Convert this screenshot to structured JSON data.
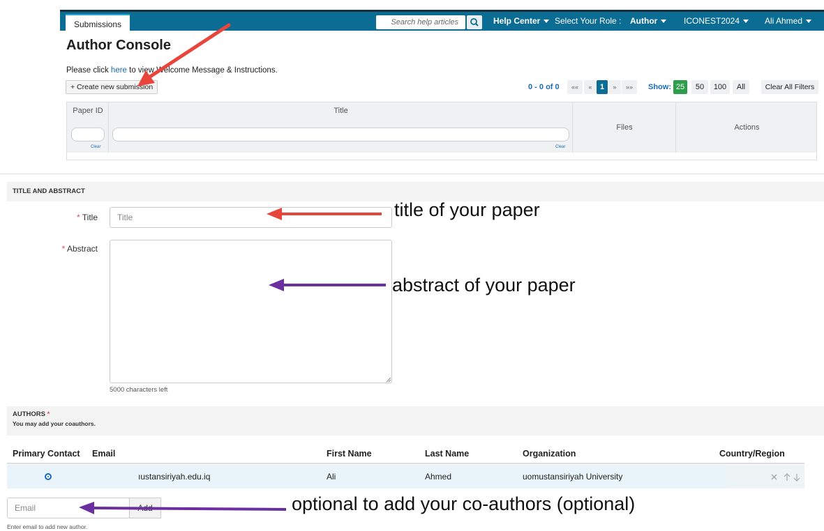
{
  "topbar": {
    "tab_label": "Submissions",
    "search_placeholder": "Search help articles",
    "help_center": "Help Center",
    "role_label": "Select Your Role :",
    "role_value": "Author",
    "conference": "ICONEST2024",
    "user": "Ali Ahmed"
  },
  "console": {
    "title": "Author Console",
    "intro_prefix": "Please click ",
    "intro_link": "here",
    "intro_suffix": " to view Welcome Message & Instructions.",
    "create_button": "+ Create new submission"
  },
  "pager": {
    "count": "0 - 0 of 0",
    "first": "««",
    "prev": "«",
    "page": "1",
    "next": "»",
    "last": "»»",
    "show_label": "Show:",
    "show_options": [
      "25",
      "50",
      "100",
      "All"
    ],
    "show_selected": "25",
    "clear_filters": "Clear All Filters"
  },
  "submissions_table": {
    "columns": [
      "Paper ID",
      "Title",
      "Files",
      "Actions"
    ],
    "clear_label": "Clear"
  },
  "title_abstract": {
    "section_label": "TITLE AND ABSTRACT",
    "title_label": "Title",
    "title_placeholder": "Title",
    "abstract_label": "Abstract",
    "chars_left": "5000 characters left"
  },
  "authors": {
    "section_label": "AUTHORS",
    "section_sub": "You may add your coauthors.",
    "columns": [
      "Primary Contact",
      "Email",
      "First Name",
      "Last Name",
      "Organization",
      "Country/Region"
    ],
    "rows": [
      {
        "email": "ıustansiriyah.edu.iq",
        "first_name": "Ali",
        "last_name": "Ahmed",
        "organization": "uomustansiriyah University",
        "country": ""
      }
    ],
    "email_placeholder": "Email",
    "add_button": "Add",
    "email_help": "Enter email to add new author."
  },
  "annotations": {
    "title_note": "title of your paper",
    "abstract_note": "abstract of your paper",
    "coauthor_note": "optional to add your co-authors (optional)"
  },
  "colors": {
    "nav_bar": "#0c6d94",
    "link": "#1a6bbf",
    "arrow_red": "#e8453c",
    "arrow_purple": "#6b2fa0",
    "show_active": "#2e9e4a"
  }
}
